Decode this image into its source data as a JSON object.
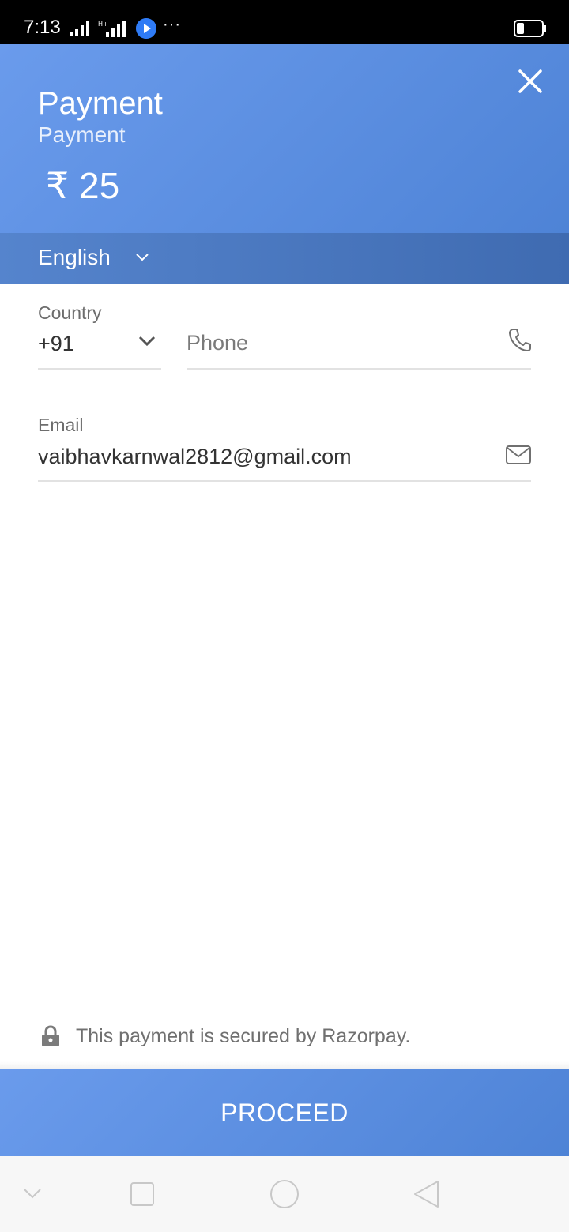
{
  "status_bar": {
    "time": "7:13",
    "network_label": "H+",
    "icons": [
      "signal-icon",
      "signal-h-plus-icon",
      "play-icon",
      "more-icon",
      "battery-icon"
    ]
  },
  "header": {
    "title": "Payment",
    "subtitle": "Payment",
    "amount": "₹ 25",
    "close_icon": "close-icon",
    "gradient_start": "#6a9bec",
    "gradient_end": "#4e83d6"
  },
  "language": {
    "selected": "English",
    "icon": "chevron-down-icon"
  },
  "form": {
    "country": {
      "label": "Country",
      "value": "+91"
    },
    "phone": {
      "value": "",
      "placeholder": "Phone",
      "icon": "phone-icon"
    },
    "email": {
      "label": "Email",
      "value": "vaibhavkarnwal2812@gmail.com",
      "icon": "mail-icon"
    }
  },
  "footer": {
    "secure_text": "This payment is secured by Razorpay.",
    "proceed_label": "PROCEED"
  },
  "nav_bar": {
    "items": [
      "hide-keyboard-icon",
      "recents-icon",
      "home-icon",
      "back-icon"
    ]
  }
}
